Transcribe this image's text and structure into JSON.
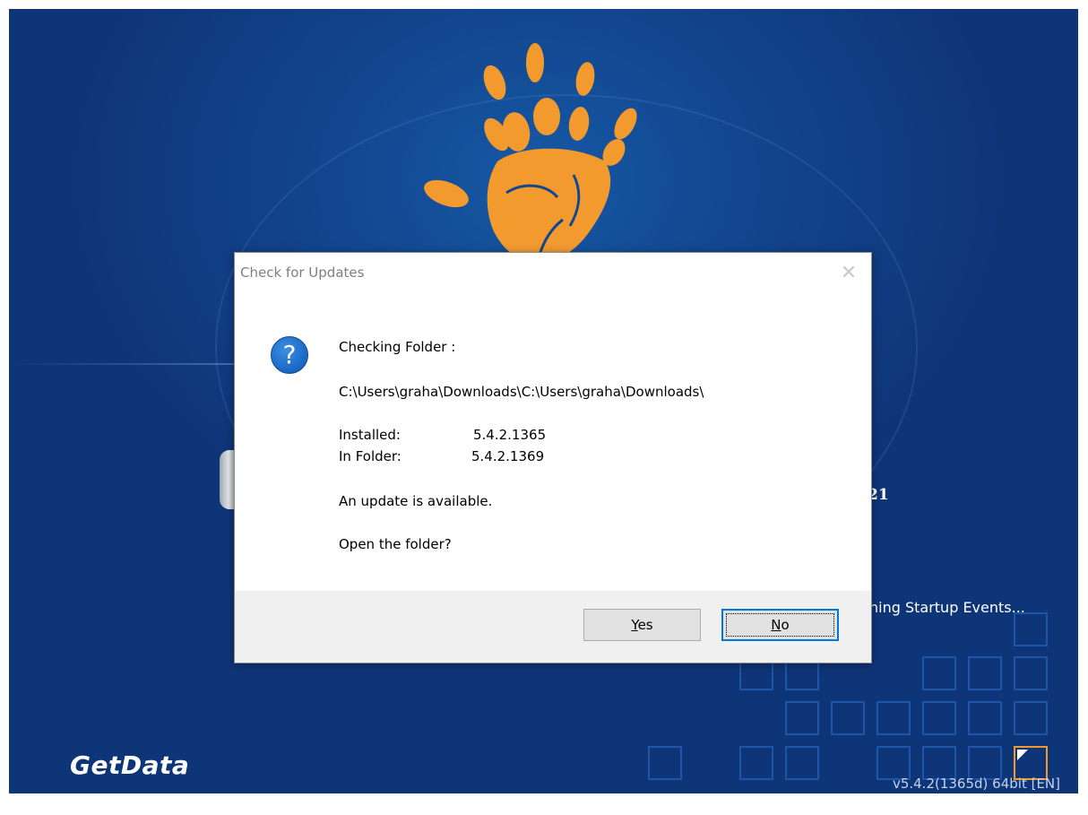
{
  "splash": {
    "brand": "GetData",
    "version": "v5.4.2(1365d) 64bit [EN]",
    "status": "ning Startup Events...",
    "title_fragment": "21",
    "colors": {
      "background": "#12468e",
      "accent": "#f29a2e",
      "tile": "#1d56a8"
    }
  },
  "dialog": {
    "title": "Check for Updates",
    "close_icon": "close-icon",
    "icon": "question-icon",
    "heading": "Checking Folder :",
    "path": "C:\\Users\\graha\\Downloads\\C:\\Users\\graha\\Downloads\\",
    "installed_label": "Installed:",
    "installed_value": "5.4.2.1365",
    "folder_label": "In Folder:",
    "folder_value": "5.4.2.1369",
    "update_msg": "An update is available.",
    "question": "Open the folder?",
    "buttons": {
      "yes_mnemonic": "Y",
      "yes_rest": "es",
      "no_mnemonic": "N",
      "no_rest": "o"
    }
  }
}
